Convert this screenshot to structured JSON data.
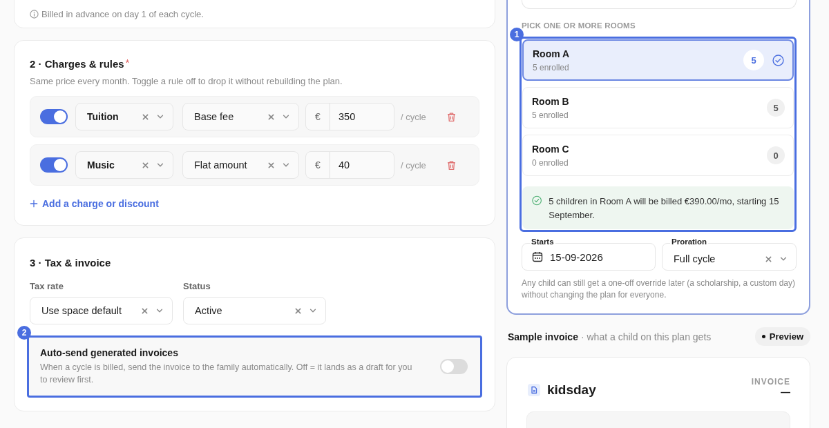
{
  "billing_note": {
    "text": "Billed in advance on day 1 of each cycle."
  },
  "charges": {
    "title": "2 · Charges & rules",
    "required_mark": "*",
    "subtitle": "Same price every month. Toggle a rule off to drop it without rebuilding the plan.",
    "rules": [
      {
        "enabled": true,
        "name": "Tuition",
        "method": "Base fee",
        "currency": "€",
        "amount": "350",
        "unit": "/ cycle"
      },
      {
        "enabled": true,
        "name": "Music",
        "method": "Flat amount",
        "currency": "€",
        "amount": "40",
        "unit": "/ cycle"
      }
    ],
    "add_link": "Add a charge or discount"
  },
  "tax": {
    "title": "3 · Tax & invoice",
    "fields": [
      {
        "label": "Tax rate",
        "value": "Use space default"
      },
      {
        "label": "Status",
        "value": "Active"
      }
    ],
    "auto_send": {
      "badge": "2",
      "title": "Auto-send generated invoices",
      "description": "When a cycle is billed, send the invoice to the family automatically. Off = it lands as a draft for you to review first.",
      "on": false
    }
  },
  "rooms": {
    "heading": "PICK ONE OR MORE ROOMS",
    "badge": "1",
    "items": [
      {
        "name": "Room A",
        "enrolled": "5 enrolled",
        "count": "5",
        "selected": true
      },
      {
        "name": "Room B",
        "enrolled": "5 enrolled",
        "count": "5",
        "selected": false
      },
      {
        "name": "Room C",
        "enrolled": "0 enrolled",
        "count": "0",
        "selected": false
      }
    ],
    "summary": "5 children in Room A will be billed €390.00/mo, starting 15 September."
  },
  "schedule": {
    "starts": {
      "label": "Starts",
      "value": "15-09-2026"
    },
    "proration": {
      "label": "Proration",
      "value": "Full cycle"
    },
    "note": "Any child can still get a one-off override later (a scholarship, a custom day) without changing the plan for everyone."
  },
  "sample_invoice": {
    "title": "Sample invoice",
    "subtitle": "· what a child on this plan gets",
    "preview_button": "Preview",
    "brand": "kidsday",
    "doc_label": "INVOICE",
    "doc_number": "—"
  }
}
